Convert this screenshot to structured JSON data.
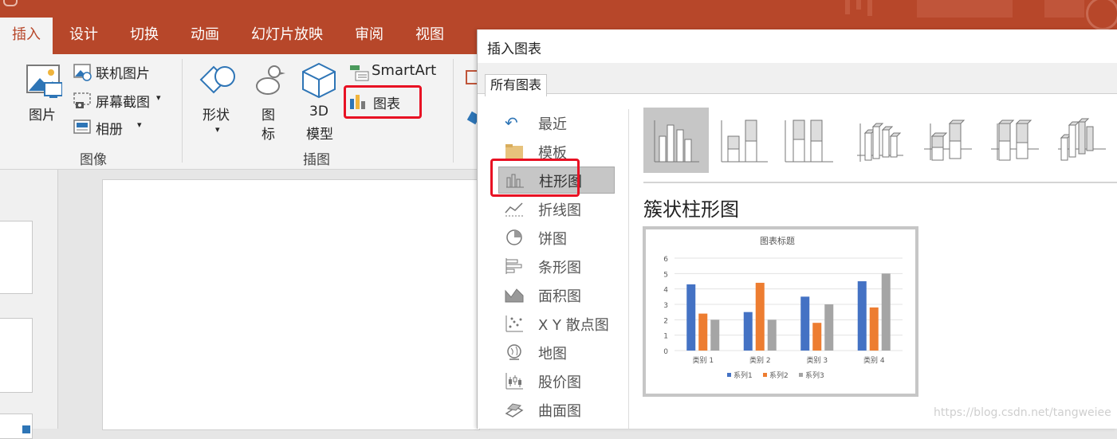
{
  "ribbon": {
    "tabs": [
      {
        "label": "插入",
        "active": true
      },
      {
        "label": "设计"
      },
      {
        "label": "切换"
      },
      {
        "label": "动画"
      },
      {
        "label": "幻灯片放映"
      },
      {
        "label": "审阅"
      },
      {
        "label": "视图"
      }
    ],
    "image_group": {
      "label": "图像",
      "picture": "图片",
      "online_pictures": "联机图片",
      "screenshot": "屏幕截图",
      "photo_album": "相册"
    },
    "illustrations_group": {
      "label": "插图",
      "shapes": "形状",
      "icons_line1": "图",
      "icons_line2": "标",
      "models_line1": "3D",
      "models_line2": "模型",
      "smartart": "SmartArt",
      "chart": "图表"
    }
  },
  "dialog": {
    "title": "插入图表",
    "tab": "所有图表",
    "categories": [
      {
        "label": "最近",
        "icon": "undo-icon"
      },
      {
        "label": "模板",
        "icon": "folder-icon"
      },
      {
        "label": "柱形图",
        "icon": "column-chart-icon",
        "selected": true
      },
      {
        "label": "折线图",
        "icon": "line-chart-icon"
      },
      {
        "label": "饼图",
        "icon": "pie-chart-icon"
      },
      {
        "label": "条形图",
        "icon": "bar-chart-icon"
      },
      {
        "label": "面积图",
        "icon": "area-chart-icon"
      },
      {
        "label": "X Y 散点图",
        "icon": "scatter-chart-icon"
      },
      {
        "label": "地图",
        "icon": "map-chart-icon"
      },
      {
        "label": "股价图",
        "icon": "stock-chart-icon"
      },
      {
        "label": "曲面图",
        "icon": "surface-chart-icon"
      }
    ],
    "subtype_heading": "簇状柱形图"
  },
  "watermark": "https://blog.csdn.net/tangweiee",
  "chart_data": {
    "type": "bar",
    "title": "图表标题",
    "categories": [
      "类别 1",
      "类别 2",
      "类别 3",
      "类别 4"
    ],
    "series": [
      {
        "name": "系列1",
        "values": [
          4.3,
          2.5,
          3.5,
          4.5
        ],
        "color": "#4472c4"
      },
      {
        "name": "系列2",
        "values": [
          2.4,
          4.4,
          1.8,
          2.8
        ],
        "color": "#ed7d31"
      },
      {
        "name": "系列3",
        "values": [
          2,
          2,
          3,
          5
        ],
        "color": "#a5a5a5"
      }
    ],
    "ylim": [
      0,
      6
    ],
    "yticks": [
      0,
      1,
      2,
      3,
      4,
      5,
      6
    ],
    "legend": "bottom",
    "grid": true
  }
}
